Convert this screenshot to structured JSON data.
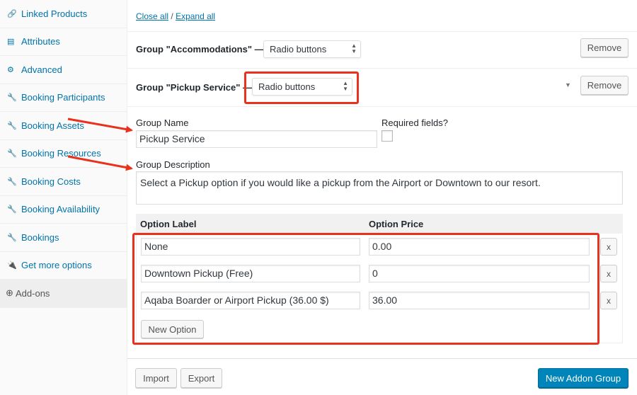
{
  "sidebar": {
    "items": [
      {
        "label": "Linked Products",
        "icon": "link-icon",
        "glyph": "🔗"
      },
      {
        "label": "Attributes",
        "icon": "table-icon",
        "glyph": "▤"
      },
      {
        "label": "Advanced",
        "icon": "gear-icon",
        "glyph": "⚙"
      },
      {
        "label": "Booking Participants",
        "icon": "wrench-icon",
        "glyph": "🔧"
      },
      {
        "label": "Booking Assets",
        "icon": "wrench-icon",
        "glyph": "🔧"
      },
      {
        "label": "Booking Resources",
        "icon": "wrench-icon",
        "glyph": "🔧"
      },
      {
        "label": "Booking Costs",
        "icon": "wrench-icon",
        "glyph": "🔧"
      },
      {
        "label": "Booking Availability",
        "icon": "wrench-icon",
        "glyph": "🔧"
      },
      {
        "label": "Bookings",
        "icon": "wrench-icon",
        "glyph": "🔧"
      },
      {
        "label": "Get more options",
        "icon": "plugin-icon",
        "glyph": "🔌"
      },
      {
        "label": "Add-ons",
        "icon": "plus-circle-icon",
        "glyph": "⊕"
      }
    ]
  },
  "links": {
    "close_all": "Close all",
    "separator": "/",
    "expand_all": "Expand all"
  },
  "group1": {
    "title": "Group \"Accommodations\" —",
    "type": "Radio buttons",
    "remove": "Remove"
  },
  "group2": {
    "title": "Group \"Pickup Service\" —",
    "type": "Radio buttons",
    "remove": "Remove"
  },
  "form": {
    "name_label": "Group Name",
    "name_value": "Pickup Service",
    "required_label": "Required fields?",
    "desc_label": "Group Description",
    "desc_value": "Select a Pickup option if you would like a pickup from the Airport or Downtown to our resort."
  },
  "options": {
    "col_label": "Option Label",
    "col_price": "Option Price",
    "rows": [
      {
        "label": "None",
        "price": "0.00",
        "remove": "x"
      },
      {
        "label": "Downtown Pickup (Free)",
        "price": "0",
        "remove": "x"
      },
      {
        "label": "Aqaba Boarder or Airport Pickup (36.00 $)",
        "price": "36.00",
        "remove": "x"
      }
    ],
    "new_option": "New Option"
  },
  "footer": {
    "import": "Import",
    "export": "Export",
    "new_group": "New Addon Group"
  },
  "colors": {
    "accent": "#0085ba",
    "link": "#0073aa",
    "highlight": "#e8321e"
  }
}
